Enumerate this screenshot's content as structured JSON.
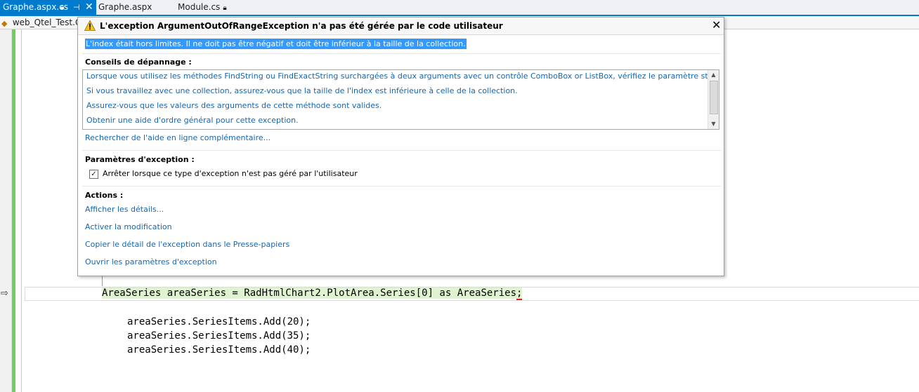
{
  "tabs": [
    {
      "label": "Graphe.aspx.cs"
    },
    {
      "label": "Graphe.aspx"
    },
    {
      "label": "Module.cs"
    }
  ],
  "navbar": {
    "project": "web_Qtel_Test.Gr"
  },
  "exception": {
    "title": "L'exception ArgumentOutOfRangeException n'a pas été gérée par le code utilisateur",
    "message": "L'index était hors limites. Il ne doit pas être négatif et doit être inférieur à la taille de la collection.",
    "tips_header": "Conseils de dépannage :",
    "tips": [
      "Lorsque vous utilisez les méthodes FindString ou FindExactString surchargées à deux arguments avec un contrôle ComboBox or ListBox, vérifiez le paramètre startIndex.",
      "Si vous travaillez avec une collection, assurez-vous que la taille de l'index est inférieure à celle de la collection.",
      "Assurez-vous que les valeurs des arguments de cette méthode sont valides.",
      "Obtenir une aide d'ordre général pour cette exception."
    ],
    "search_link": "Rechercher de l'aide en ligne complémentaire...",
    "settings_header": "Paramètres d'exception :",
    "settings_checkbox_label": "Arrêter lorsque ce type d'exception n'est pas géré par l'utilisateur",
    "settings_checkbox_checked": true,
    "actions_header": "Actions :",
    "actions": [
      "Afficher les détails...",
      "Activer la modification",
      "Copier le détail de l'exception dans le Presse-papiers",
      "Ouvrir les paramètres d'exception"
    ]
  },
  "code": {
    "current_line": "AreaSeries areaSeries = RadHtmlChart2.PlotArea.Series[0] as AreaSeries",
    "current_line_end": ";",
    "lines": [
      "areaSeries.SeriesItems.Add(20);",
      "areaSeries.SeriesItems.Add(35);",
      "areaSeries.SeriesItems.Add(40);"
    ]
  },
  "colors": {
    "accent": "#007acc",
    "link": "#1566b2",
    "selection": "#3399ff",
    "current_statement": "#e0f3d0",
    "change_bar": "#6fcf5c"
  },
  "icons": {
    "warning": "warning-icon",
    "close": "close-icon",
    "lock": "lock-icon",
    "pin": "pin-icon",
    "execution_pointer": "execution-pointer-icon"
  }
}
